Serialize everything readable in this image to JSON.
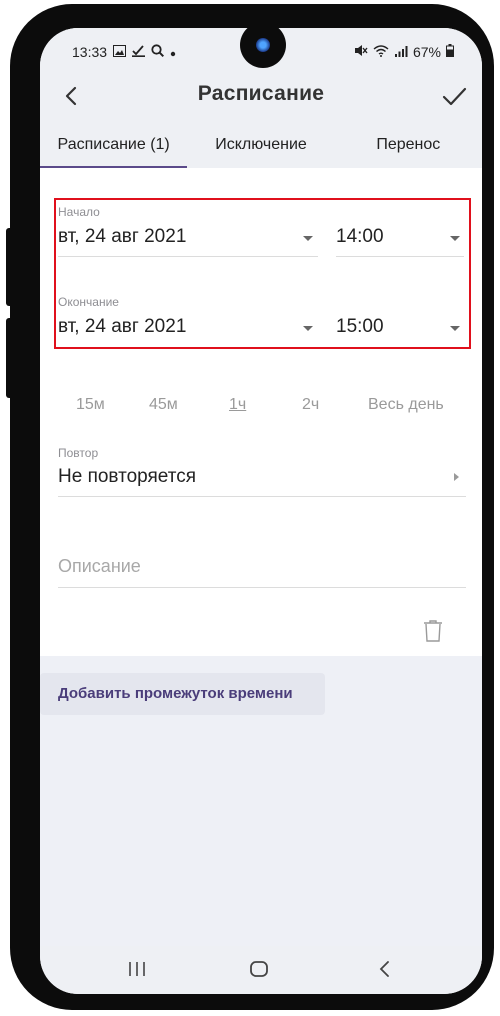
{
  "status_bar": {
    "time": "13:33",
    "battery": "67%",
    "left_icons": [
      "gallery-icon",
      "check-download-icon",
      "search-icon",
      "dot-icon"
    ],
    "right_icons": [
      "mute-icon",
      "wifi-icon",
      "signal-icon",
      "battery-icon"
    ]
  },
  "app_bar": {
    "title": "Расписание",
    "back_icon": "chevron-left-icon",
    "confirm_icon": "check-icon"
  },
  "tabs": [
    {
      "label": "Расписание (1)",
      "active": true
    },
    {
      "label": "Исключение",
      "active": false
    },
    {
      "label": "Перенос",
      "active": false
    }
  ],
  "start": {
    "label": "Начало",
    "date": "вт, 24 авг 2021",
    "time": "14:00"
  },
  "end": {
    "label": "Окончание",
    "date": "вт, 24 авг 2021",
    "time": "15:00"
  },
  "durations": [
    {
      "label": "15м",
      "selected": false
    },
    {
      "label": "45м",
      "selected": false
    },
    {
      "label": "1ч",
      "selected": true
    },
    {
      "label": "2ч",
      "selected": false
    },
    {
      "label": "Весь день",
      "selected": false
    }
  ],
  "repeat": {
    "label": "Повтор",
    "value": "Не повторяется"
  },
  "description": {
    "placeholder": "Описание"
  },
  "add_interval_label": "Добавить промежуток времени",
  "colors": {
    "accent": "#5b4a8a",
    "highlight": "#e0101c",
    "background": "#eef0f4"
  }
}
